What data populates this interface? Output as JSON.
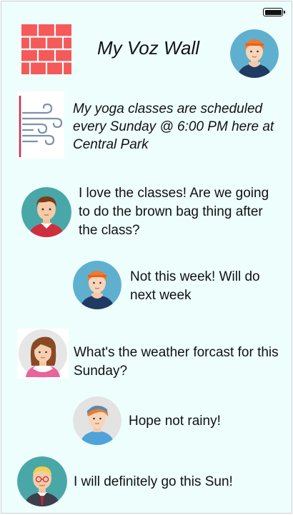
{
  "header": {
    "title": "My Voz Wall",
    "logo_icon": "brick-wall-icon",
    "profile_icon": "user-avatar"
  },
  "post": {
    "icon": "wind-weather-icon",
    "text": "My yoga classes are scheduled every Sunday @ 6:00 PM here at Central Park"
  },
  "messages": [
    {
      "avatar": "boy-avatar",
      "text": "I love the classes! Are we going to do the brown bag thing after the class?"
    },
    {
      "avatar": "redhead-avatar",
      "text": "Not this week! Will do next week"
    },
    {
      "avatar": "woman-avatar",
      "text": "What's the weather forcast for this Sunday?"
    },
    {
      "avatar": "teen-boy-avatar",
      "text": "Hope not rainy!"
    },
    {
      "avatar": "old-man-avatar",
      "text": "I will definitely go this Sun!"
    }
  ],
  "colors": {
    "background": "#eefefd",
    "brick": "#f55a5a",
    "avatar_teal": "#4aa7a8",
    "avatar_blue": "#5fb0cf"
  }
}
